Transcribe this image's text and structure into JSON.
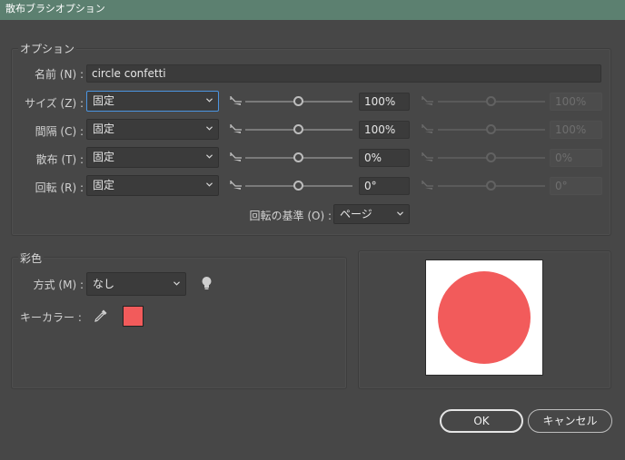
{
  "window": {
    "title": "散布ブラシオプション"
  },
  "options": {
    "group_title": "オプション",
    "name_label": "名前 (N) :",
    "name_value": "circle confetti",
    "rows": [
      {
        "label": "サイズ (Z) :",
        "mode": "固定",
        "value": "100%",
        "value2": "100%",
        "focused": true
      },
      {
        "label": "間隔 (C) :",
        "mode": "固定",
        "value": "100%",
        "value2": "100%",
        "focused": false
      },
      {
        "label": "散布 (T) :",
        "mode": "固定",
        "value": "0%",
        "value2": "0%",
        "focused": false
      },
      {
        "label": "回転 (R) :",
        "mode": "固定",
        "value": "0°",
        "value2": "0°",
        "focused": false
      }
    ],
    "rotation_basis_label": "回転の基準 (O) :",
    "rotation_basis_value": "ページ"
  },
  "colorization": {
    "group_title": "彩色",
    "method_label": "方式 (M) :",
    "method_value": "なし",
    "key_color_label": "キーカラー :",
    "key_color": "#f25b5b",
    "tips_icon": "lightbulb-icon",
    "eyedropper_icon": "eyedropper-icon"
  },
  "preview": {
    "shape_color": "#f25b5b"
  },
  "buttons": {
    "ok": "OK",
    "cancel": "キャンセル"
  },
  "colors": {
    "titlebar": "#5c8070",
    "background": "#474747",
    "focus": "#4b94e0"
  }
}
